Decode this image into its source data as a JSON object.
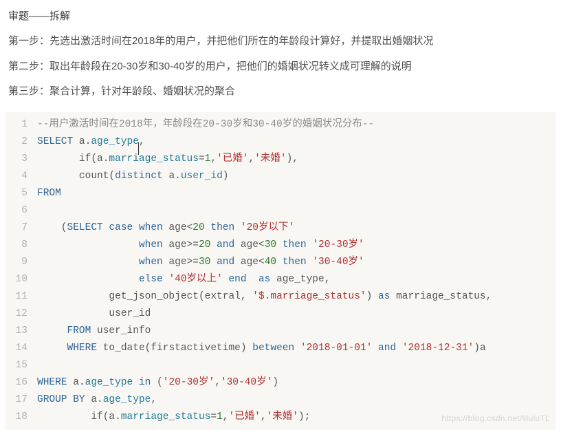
{
  "heading": "审题——拆解",
  "steps": [
    "第一步：先选出激活时间在2018年的用户，并把他们所在的年龄段计算好，并提取出婚姻状况",
    "第二步：取出年龄段在20-30岁和30-40岁的用户，把他们的婚姻状况转义成可理解的说明",
    "第三步：聚合计算，针对年龄段、婚姻状况的聚合"
  ],
  "code": {
    "lines": [
      {
        "n": 1,
        "tokens": [
          {
            "t": "--用户激活时间在2018年，年龄段在20-30岁和30-40岁的婚姻状况分布--",
            "c": "c-comment"
          }
        ]
      },
      {
        "n": 2,
        "tokens": [
          {
            "t": "SELECT",
            "c": "c-keyword"
          },
          {
            "t": " a.",
            "c": "c-plain"
          },
          {
            "t": "age_type",
            "c": "c-ident",
            "cursor": true
          },
          {
            "t": ",",
            "c": "c-plain"
          }
        ]
      },
      {
        "n": 3,
        "tokens": [
          {
            "t": "       if(a.",
            "c": "c-plain"
          },
          {
            "t": "marriage_status",
            "c": "c-ident"
          },
          {
            "t": "=",
            "c": "c-plain"
          },
          {
            "t": "1",
            "c": "c-number"
          },
          {
            "t": ",",
            "c": "c-plain"
          },
          {
            "t": "'已婚'",
            "c": "c-string"
          },
          {
            "t": ",",
            "c": "c-plain"
          },
          {
            "t": "'未婚'",
            "c": "c-string"
          },
          {
            "t": "),",
            "c": "c-plain"
          }
        ]
      },
      {
        "n": 4,
        "tokens": [
          {
            "t": "       count(",
            "c": "c-plain"
          },
          {
            "t": "distinct",
            "c": "c-keyword"
          },
          {
            "t": " a.",
            "c": "c-plain"
          },
          {
            "t": "user_id",
            "c": "c-ident"
          },
          {
            "t": ")",
            "c": "c-plain"
          }
        ]
      },
      {
        "n": 5,
        "tokens": [
          {
            "t": "FROM",
            "c": "c-keyword"
          }
        ]
      },
      {
        "n": 6,
        "tokens": [
          {
            "t": "",
            "c": "c-plain"
          }
        ]
      },
      {
        "n": 7,
        "tokens": [
          {
            "t": "    (",
            "c": "c-plain"
          },
          {
            "t": "SELECT",
            "c": "c-keyword"
          },
          {
            "t": " ",
            "c": "c-plain"
          },
          {
            "t": "case",
            "c": "c-keyword"
          },
          {
            "t": " ",
            "c": "c-plain"
          },
          {
            "t": "when",
            "c": "c-keyword"
          },
          {
            "t": " age<",
            "c": "c-plain"
          },
          {
            "t": "20",
            "c": "c-number"
          },
          {
            "t": " ",
            "c": "c-plain"
          },
          {
            "t": "then",
            "c": "c-keyword"
          },
          {
            "t": " ",
            "c": "c-plain"
          },
          {
            "t": "'20岁以下'",
            "c": "c-string"
          }
        ]
      },
      {
        "n": 8,
        "tokens": [
          {
            "t": "                 ",
            "c": "c-plain"
          },
          {
            "t": "when",
            "c": "c-keyword"
          },
          {
            "t": " age>=",
            "c": "c-plain"
          },
          {
            "t": "20",
            "c": "c-number"
          },
          {
            "t": " ",
            "c": "c-plain"
          },
          {
            "t": "and",
            "c": "c-keyword"
          },
          {
            "t": " age<",
            "c": "c-plain"
          },
          {
            "t": "30",
            "c": "c-number"
          },
          {
            "t": " ",
            "c": "c-plain"
          },
          {
            "t": "then",
            "c": "c-keyword"
          },
          {
            "t": " ",
            "c": "c-plain"
          },
          {
            "t": "'20-30岁'",
            "c": "c-string"
          }
        ]
      },
      {
        "n": 9,
        "tokens": [
          {
            "t": "                 ",
            "c": "c-plain"
          },
          {
            "t": "when",
            "c": "c-keyword"
          },
          {
            "t": " age>=",
            "c": "c-plain"
          },
          {
            "t": "30",
            "c": "c-number"
          },
          {
            "t": " ",
            "c": "c-plain"
          },
          {
            "t": "and",
            "c": "c-keyword"
          },
          {
            "t": " age<",
            "c": "c-plain"
          },
          {
            "t": "40",
            "c": "c-number"
          },
          {
            "t": " ",
            "c": "c-plain"
          },
          {
            "t": "then",
            "c": "c-keyword"
          },
          {
            "t": " ",
            "c": "c-plain"
          },
          {
            "t": "'30-40岁'",
            "c": "c-string"
          }
        ]
      },
      {
        "n": 10,
        "tokens": [
          {
            "t": "                 ",
            "c": "c-plain"
          },
          {
            "t": "else",
            "c": "c-keyword"
          },
          {
            "t": " ",
            "c": "c-plain"
          },
          {
            "t": "'40岁以上'",
            "c": "c-string"
          },
          {
            "t": " ",
            "c": "c-plain"
          },
          {
            "t": "end",
            "c": "c-keyword"
          },
          {
            "t": "  ",
            "c": "c-plain"
          },
          {
            "t": "as",
            "c": "c-keyword"
          },
          {
            "t": " age_type,",
            "c": "c-plain"
          }
        ]
      },
      {
        "n": 11,
        "tokens": [
          {
            "t": "            get_json_object(extral, ",
            "c": "c-plain"
          },
          {
            "t": "'$.marriage_status'",
            "c": "c-string"
          },
          {
            "t": ") ",
            "c": "c-plain"
          },
          {
            "t": "as",
            "c": "c-keyword"
          },
          {
            "t": " marriage_status,",
            "c": "c-plain"
          }
        ]
      },
      {
        "n": 12,
        "tokens": [
          {
            "t": "            user_id",
            "c": "c-plain"
          }
        ]
      },
      {
        "n": 13,
        "tokens": [
          {
            "t": "     ",
            "c": "c-plain"
          },
          {
            "t": "FROM",
            "c": "c-keyword"
          },
          {
            "t": " user_info",
            "c": "c-plain"
          }
        ]
      },
      {
        "n": 14,
        "tokens": [
          {
            "t": "     ",
            "c": "c-plain"
          },
          {
            "t": "WHERE",
            "c": "c-keyword"
          },
          {
            "t": " to_date(firstactivetime) ",
            "c": "c-plain"
          },
          {
            "t": "between",
            "c": "c-keyword"
          },
          {
            "t": " ",
            "c": "c-plain"
          },
          {
            "t": "'2018-01-01'",
            "c": "c-string"
          },
          {
            "t": " ",
            "c": "c-plain"
          },
          {
            "t": "and",
            "c": "c-keyword"
          },
          {
            "t": " ",
            "c": "c-plain"
          },
          {
            "t": "'2018-12-31'",
            "c": "c-string"
          },
          {
            "t": ")a",
            "c": "c-plain"
          }
        ]
      },
      {
        "n": 15,
        "tokens": [
          {
            "t": "",
            "c": "c-plain"
          }
        ]
      },
      {
        "n": 16,
        "tokens": [
          {
            "t": "WHERE",
            "c": "c-keyword"
          },
          {
            "t": " a.",
            "c": "c-plain"
          },
          {
            "t": "age_type",
            "c": "c-ident"
          },
          {
            "t": " ",
            "c": "c-plain"
          },
          {
            "t": "in",
            "c": "c-keyword"
          },
          {
            "t": " (",
            "c": "c-plain"
          },
          {
            "t": "'20-30岁'",
            "c": "c-string"
          },
          {
            "t": ",",
            "c": "c-plain"
          },
          {
            "t": "'30-40岁'",
            "c": "c-string"
          },
          {
            "t": ")",
            "c": "c-plain"
          }
        ]
      },
      {
        "n": 17,
        "tokens": [
          {
            "t": "GROUP BY",
            "c": "c-keyword"
          },
          {
            "t": " a.",
            "c": "c-plain"
          },
          {
            "t": "age_type",
            "c": "c-ident"
          },
          {
            "t": ",",
            "c": "c-plain"
          }
        ]
      },
      {
        "n": 18,
        "tokens": [
          {
            "t": "         if(a.",
            "c": "c-plain"
          },
          {
            "t": "marriage_status",
            "c": "c-ident"
          },
          {
            "t": "=",
            "c": "c-plain"
          },
          {
            "t": "1",
            "c": "c-number"
          },
          {
            "t": ",",
            "c": "c-plain"
          },
          {
            "t": "'已婚'",
            "c": "c-string"
          },
          {
            "t": ",",
            "c": "c-plain"
          },
          {
            "t": "'未婚'",
            "c": "c-string"
          },
          {
            "t": ");",
            "c": "c-plain"
          }
        ]
      }
    ]
  },
  "watermark": "https://blog.csdn.net/liluluTL"
}
